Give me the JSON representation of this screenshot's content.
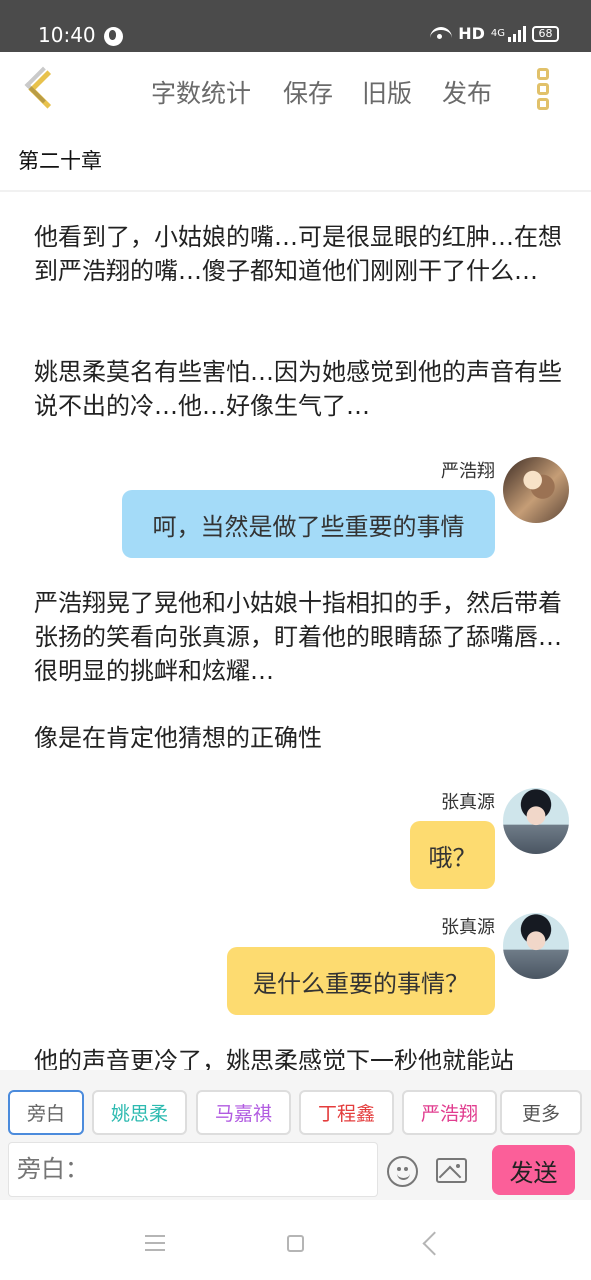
{
  "status_bar": {
    "time": "10:40",
    "network": "HD",
    "signal": "4G",
    "battery": "68"
  },
  "toolbar": {
    "word_count_label": "字数统计",
    "save_label": "保存",
    "old_version_label": "旧版",
    "publish_label": "发布",
    "accent_color": "#e8c24d",
    "icons": {
      "back": "back-chevron-icon",
      "more": "more-vertical-icon"
    }
  },
  "chapter": {
    "title": "第二十章"
  },
  "story": {
    "items": [
      {
        "type": "narration",
        "text": "他看到了，小姑娘的嘴…可是很显眼的红肿…在想到严浩翔的嘴…傻子都知道他们刚刚干了什么…"
      },
      {
        "type": "narration",
        "text": "姚思柔莫名有些害怕…因为她感觉到他的声音有些说不出的冷…他…好像生气了…"
      },
      {
        "type": "dialogue",
        "speaker": "严浩翔",
        "text": "呵，当然是做了些重要的事情",
        "bubble_color": "#a4dbf8",
        "avatar": "person-photo-avatar"
      },
      {
        "type": "narration",
        "text": "严浩翔晃了晃他和小姑娘十指相扣的手，然后带着张扬的笑看向张真源，盯着他的眼睛舔了舔嘴唇…很明显的挑衅和炫耀…"
      },
      {
        "type": "narration",
        "text": "像是在肯定他猜想的正确性"
      },
      {
        "type": "dialogue",
        "speaker": "张真源",
        "text": "哦？",
        "bubble_color": "#fddb70",
        "avatar": "boy-portrait-avatar"
      },
      {
        "type": "dialogue",
        "speaker": "张真源",
        "text": "是什么重要的事情？",
        "bubble_color": "#fddb70",
        "avatar": "boy-portrait-avatar"
      },
      {
        "type": "narration",
        "text": "他的声音更冷了，姚思柔感觉下一秒他就能站"
      }
    ]
  },
  "characters": {
    "items": [
      {
        "label": "旁白",
        "color": "#666666"
      },
      {
        "label": "姚思柔",
        "color": "#2dbab0"
      },
      {
        "label": "马嘉祺",
        "color": "#b15be1"
      },
      {
        "label": "丁程鑫",
        "color": "#e43d3d"
      },
      {
        "label": "严浩翔",
        "color": "#e13d8f"
      },
      {
        "label": "更多",
        "color": "#555555"
      }
    ]
  },
  "composer": {
    "placeholder": "旁白：",
    "send_label": "发送",
    "send_color": "#fb5f99",
    "icons": {
      "emoji": "emoji-face-icon",
      "image": "image-icon"
    }
  },
  "system_nav": {
    "icons": [
      "menu-icon",
      "home-icon",
      "back-icon"
    ]
  }
}
